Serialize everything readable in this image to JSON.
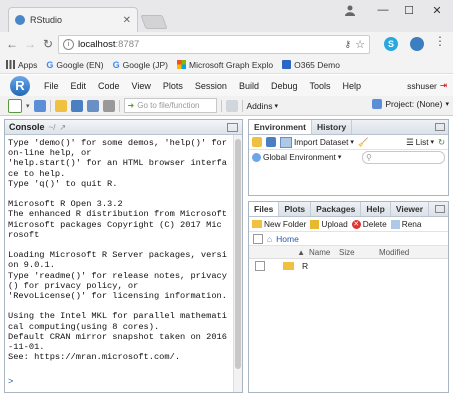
{
  "browser": {
    "tab_title": "RStudio",
    "url_host": "localhost",
    "url_port": ":8787",
    "bookmarks": [
      {
        "label": "Apps",
        "icon": "apps-grid-icon"
      },
      {
        "label": "Google (EN)",
        "icon": "google-icon"
      },
      {
        "label": "Google (JP)",
        "icon": "google-icon"
      },
      {
        "label": "Microsoft Graph Explo",
        "icon": "microsoft-icon"
      },
      {
        "label": "O365 Demo",
        "icon": "office-icon"
      }
    ]
  },
  "rstudio": {
    "menu": [
      "File",
      "Edit",
      "Code",
      "View",
      "Plots",
      "Session",
      "Build",
      "Debug",
      "Tools",
      "Help"
    ],
    "user": "sshuser",
    "goto_placeholder": "Go to file/function",
    "addins_label": "Addins",
    "project_label": "Project: (None)"
  },
  "console": {
    "title": "Console",
    "path": "~/",
    "lines": [
      "Type 'demo()' for some demos, 'help()' for",
      "on-line help, or",
      "'help.start()' for an HTML browser interfa",
      "ce to help.",
      "Type 'q()' to quit R.",
      "",
      "Microsoft R Open 3.3.2",
      "The enhanced R distribution from Microsoft",
      "Microsoft packages Copyright (C) 2017 Mic",
      "rosoft",
      "",
      "Loading Microsoft R Server packages, versi",
      "on 9.0.1.",
      "Type 'readme()' for release notes, privacy",
      "() for privacy policy, or",
      "'RevoLicense()' for licensing information.",
      "",
      "Using the Intel MKL for parallel mathemati",
      "cal computing(using 8 cores).",
      "Default CRAN mirror snapshot taken on 2016",
      "-11-01.",
      "See: https://mran.microsoft.com/."
    ],
    "prompt": ">"
  },
  "env_pane": {
    "tabs": [
      "Environment",
      "History"
    ],
    "import_label": "Import Dataset",
    "list_label": "List",
    "scope_label": "Global Environment"
  },
  "files_pane": {
    "tabs": [
      "Files",
      "Plots",
      "Packages",
      "Help",
      "Viewer"
    ],
    "new_folder": "New Folder",
    "upload": "Upload",
    "delete": "Delete",
    "rename": "Rena",
    "breadcrumb_home": "Home",
    "columns": [
      "Name",
      "Size",
      "Modified"
    ],
    "rows": [
      {
        "name": "R"
      }
    ]
  }
}
